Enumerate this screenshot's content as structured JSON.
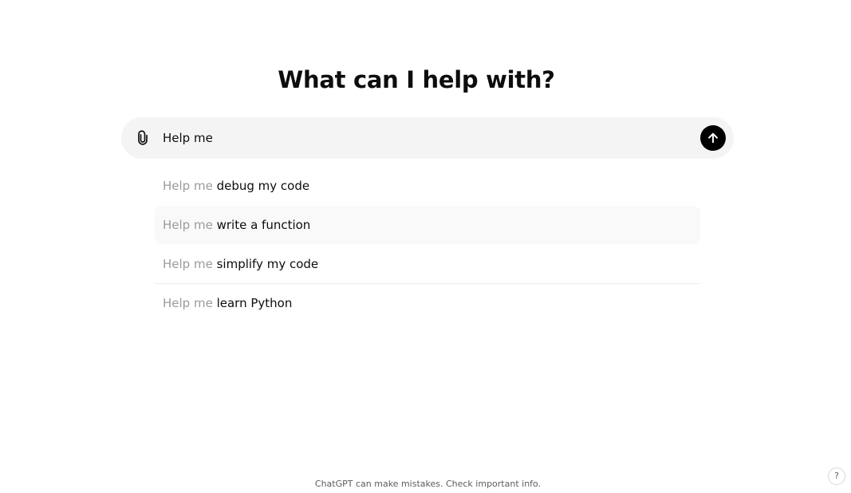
{
  "main": {
    "heading": "What can I help with?"
  },
  "composer": {
    "input_value": "Help me",
    "attach_icon": "paperclip-icon",
    "send_icon": "arrow-up-icon"
  },
  "suggestions": [
    {
      "prefix": "Help me",
      "completion": "debug my code"
    },
    {
      "prefix": "Help me",
      "completion": "write a function"
    },
    {
      "prefix": "Help me",
      "completion": "simplify my code"
    },
    {
      "prefix": "Help me",
      "completion": "learn Python"
    }
  ],
  "footer": {
    "disclaimer": "ChatGPT can make mistakes. Check important info.",
    "help_label": "?"
  },
  "colors": {
    "composer_bg": "#f4f4f4",
    "send_button": "#000000",
    "prefix_text": "#9b9b9b",
    "highlight_row": "#f9f9f9"
  }
}
